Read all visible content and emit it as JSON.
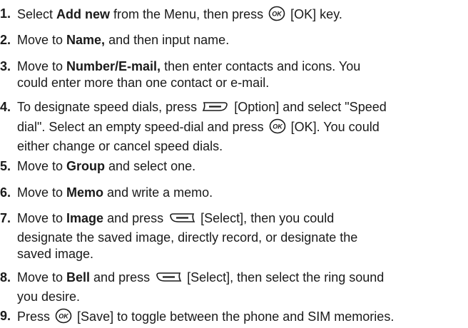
{
  "icons": {
    "ok_key": "ok-key-icon",
    "option_softkey": "left-softkey-icon",
    "select_softkey": "right-softkey-icon"
  },
  "steps": [
    {
      "number": "1.",
      "t1": "Select ",
      "b1": "Add new",
      "t2": " from the Menu, then press",
      "t3": "[OK] key."
    },
    {
      "number": "2.",
      "t1": "Move to ",
      "b1": "Name,",
      "t2": " and then input name."
    },
    {
      "number": "3.",
      "t1": "Move to ",
      "b1": "Number/E-mail,",
      "t2": " then enter contacts and icons. You",
      "t3": "could enter more than one contact or e-mail."
    },
    {
      "number": "4.",
      "t1": "To designate speed dials, press",
      "t2": "[Option] and select \"Speed",
      "t3": "dial\". Select an empty speed-dial and press",
      "t4": "[OK]. You could",
      "t5": "either change or cancel speed dials."
    },
    {
      "number": "5.",
      "t1": "Move to ",
      "b1": "Group",
      "t2": " and select one."
    },
    {
      "number": "6.",
      "t1": "Move to ",
      "b1": "Memo",
      "t2": " and write a memo."
    },
    {
      "number": "7.",
      "t1": "Move to ",
      "b1": "Image",
      "t2": " and press",
      "t3": "[Select], then you could",
      "t4": "designate the saved image, directly record, or designate the",
      "t5": "saved image."
    },
    {
      "number": "8.",
      "t1": "Move to ",
      "b1": "Bell",
      "t2": " and press",
      "t3": "[Select], then select the ring sound",
      "t4": "you desire."
    },
    {
      "number": "9.",
      "t1": "Press",
      "t2": "[Save] to toggle between the phone and SIM memories."
    }
  ]
}
